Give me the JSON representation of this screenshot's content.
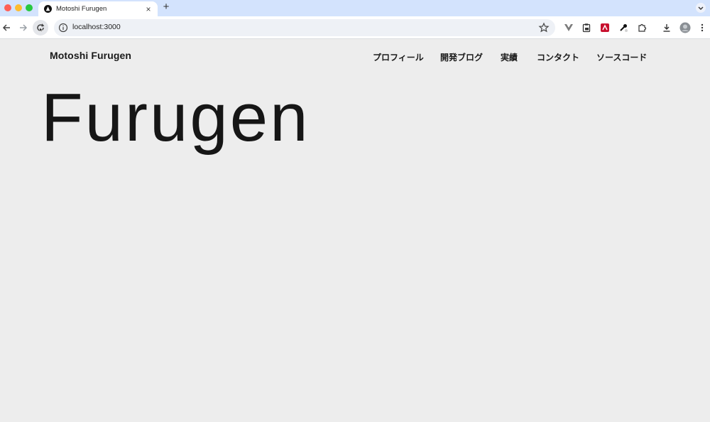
{
  "browser": {
    "tab": {
      "title": "Motoshi Furugen",
      "close": "×"
    },
    "new_tab": "+",
    "address": {
      "url": "localhost:3000"
    }
  },
  "site": {
    "logo": "Motoshi Furugen",
    "nav": [
      {
        "label": "プロフィール"
      },
      {
        "label": "開発ブログ"
      },
      {
        "label": "実績"
      },
      {
        "label": "コンタクト"
      },
      {
        "label": "ソースコード"
      }
    ],
    "hero": "Furugen"
  },
  "colors": {
    "tabstrip": "#d3e3fd",
    "page_background": "#ededed",
    "text": "#1a1a1a"
  }
}
